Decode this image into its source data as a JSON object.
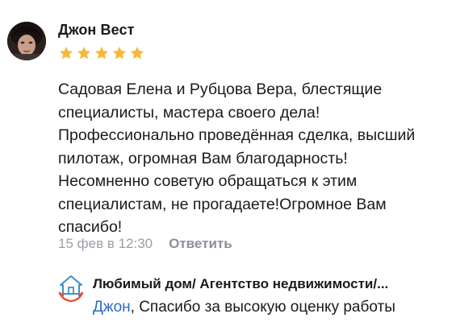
{
  "review": {
    "author_name": "Джон Вест",
    "rating": 5,
    "max_rating": 5,
    "star_color": "#f5b93a",
    "text_lines": [
      "Садовая Елена и Рубцова Вера, блестящие",
      "специалисты, мастера своего дела!",
      "Профессионально проведённая сделка, высший",
      "пилотаж, огромная Вам благодарность!",
      "Несомненно советую обращаться к этим",
      "специалистам, не прогадаете!Огромное Вам",
      "спасибо!"
    ],
    "timestamp": "15 фев в 12:30",
    "reply_label": "Ответить"
  },
  "reply": {
    "org_name": "Любимый дом/ Агентство недвижимости/...",
    "mention": "Джон",
    "text": ", Спасибо за высокую оценку работы",
    "mention_color": "#2a6cc4",
    "icon": "house-hands-icon"
  }
}
